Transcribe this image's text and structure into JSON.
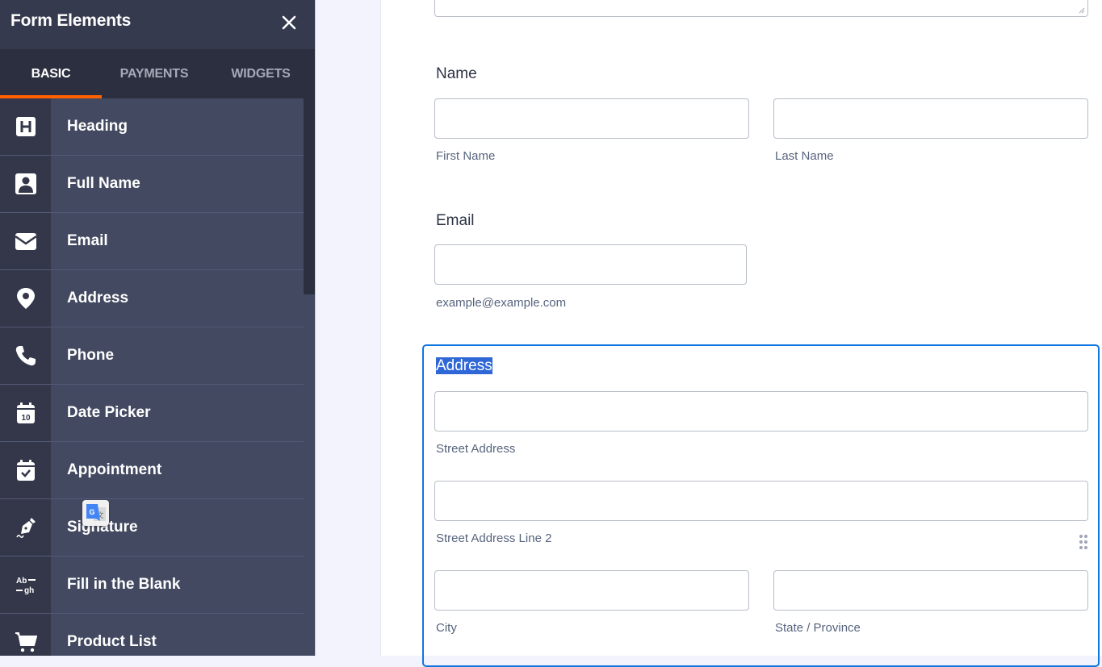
{
  "sidebar": {
    "title": "Form Elements",
    "close_icon": "close-icon",
    "tabs": [
      {
        "label": "BASIC",
        "active": true
      },
      {
        "label": "PAYMENTS",
        "active": false
      },
      {
        "label": "WIDGETS",
        "active": false
      }
    ],
    "accent_color": "#ff6100",
    "items": [
      {
        "label": "Heading",
        "icon": "heading-icon"
      },
      {
        "label": "Full Name",
        "icon": "user-icon"
      },
      {
        "label": "Email",
        "icon": "envelope-icon"
      },
      {
        "label": "Address",
        "icon": "map-pin-icon"
      },
      {
        "label": "Phone",
        "icon": "phone-icon"
      },
      {
        "label": "Date Picker",
        "icon": "calendar-icon"
      },
      {
        "label": "Appointment",
        "icon": "calendar-check-icon"
      },
      {
        "label": "Signature",
        "icon": "pen-nib-icon"
      },
      {
        "label": "Fill in the Blank",
        "icon": "fill-blank-icon"
      },
      {
        "label": "Product List",
        "icon": "cart-icon"
      }
    ]
  },
  "form": {
    "name": {
      "label": "Name",
      "first_sub": "First Name",
      "last_sub": "Last Name",
      "first_value": "",
      "last_value": ""
    },
    "email": {
      "label": "Email",
      "sub": "example@example.com",
      "value": ""
    },
    "address": {
      "label": "Address",
      "street_sub": "Street Address",
      "street2_sub": "Street Address Line 2",
      "city_sub": "City",
      "state_sub": "State / Province",
      "selected_border_color": "#0f75e0"
    }
  },
  "overlay": {
    "translate_icon": "google-translate-icon"
  }
}
